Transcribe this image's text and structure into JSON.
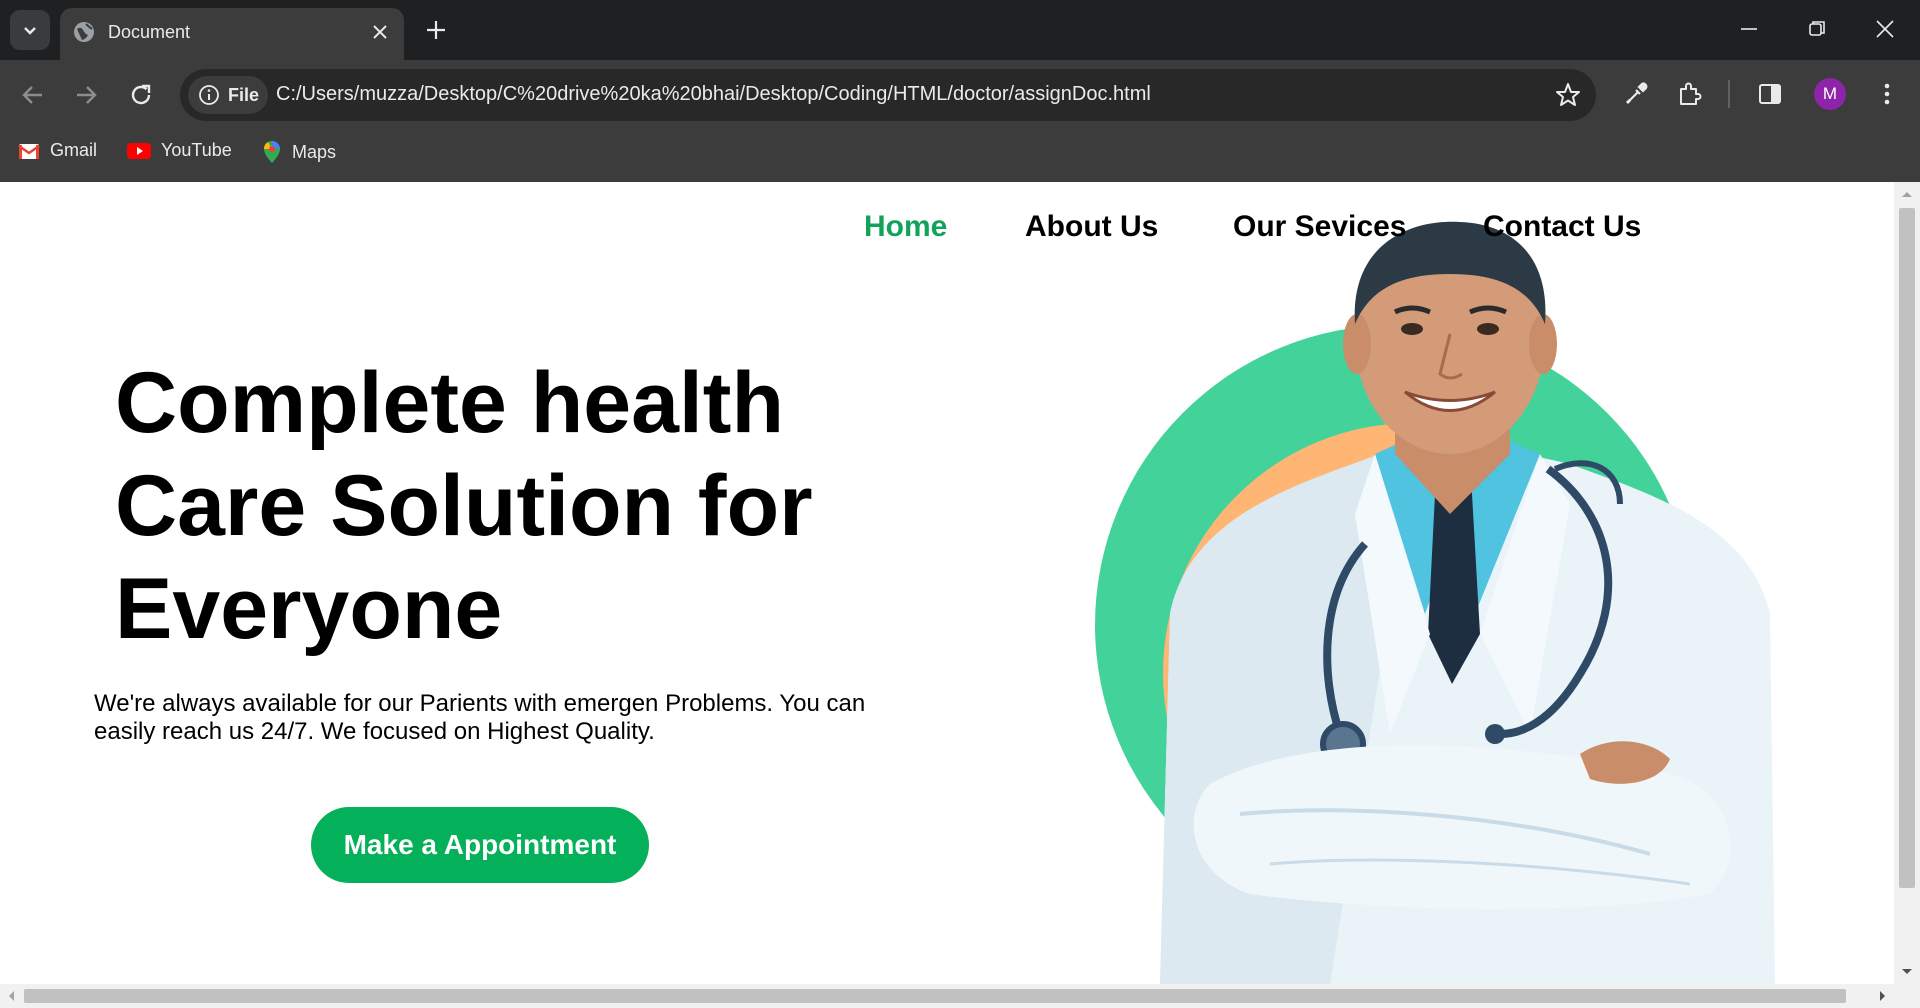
{
  "browser": {
    "tab_title": "Document",
    "chip_label": "File",
    "url": "C:/Users/muzza/Desktop/C%20drive%20ka%20bhai/Desktop/Coding/HTML/doctor/assignDoc.html",
    "avatar_letter": "M",
    "icons": [
      "tab-search-icon",
      "globe-icon",
      "close-icon",
      "plus-icon",
      "minimize-icon",
      "restore-icon",
      "window-close-icon",
      "back-icon",
      "forward-icon",
      "reload-icon",
      "info-icon",
      "star-icon",
      "eyedropper-icon",
      "extensions-icon",
      "side-panel-icon",
      "more-vert-icon"
    ],
    "bookmarks": [
      {
        "label": "Gmail",
        "icon": "gmail-icon"
      },
      {
        "label": "YouTube",
        "icon": "youtube-icon"
      },
      {
        "label": "Maps",
        "icon": "maps-icon"
      }
    ]
  },
  "page": {
    "nav": {
      "home": "Home",
      "about": "About Us",
      "services": "Our Sevices",
      "contact": "Contact Us"
    },
    "hero": {
      "title_line1": "Complete health",
      "title_line2": "Care Solution for",
      "title_line3": "Everyone",
      "text": "We're always available for our Parients with emergen Problems. You can easily reach us 24/7. We focused on Highest Quality.",
      "cta": "Make a Appointment"
    },
    "colors": {
      "accent": "#12a35a",
      "button": "#05b05a",
      "circle_green": "#43d39a",
      "circle_orange": "#ffb574"
    }
  }
}
